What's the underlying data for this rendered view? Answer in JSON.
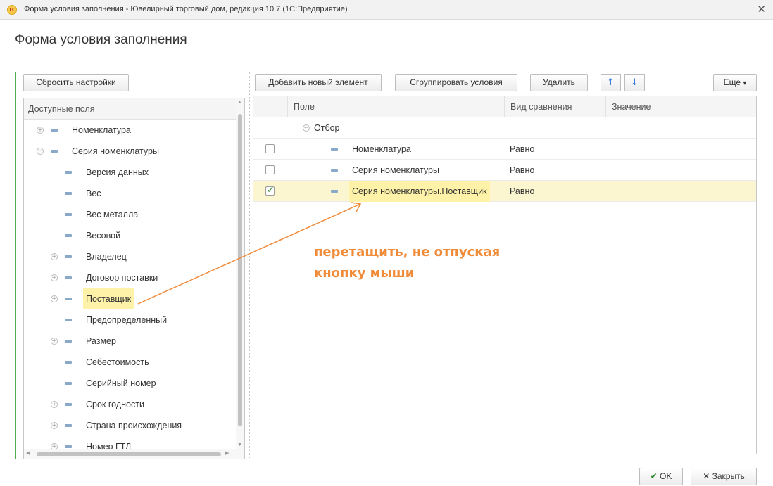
{
  "window": {
    "title": "Форма условия заполнения - Ювелирный торговый дом, редакция 10.7 (1С:Предприятие)",
    "logo_text": "1C"
  },
  "form": {
    "title": "Форма условия заполнения"
  },
  "left": {
    "reset_label": "Сбросить настройки",
    "header": "Доступные поля",
    "items": [
      {
        "label": "Номенклатура",
        "level": 0,
        "expander": "plus"
      },
      {
        "label": "Серия номенклатуры",
        "level": 0,
        "expander": "minus"
      },
      {
        "label": "Версия данных",
        "level": 1,
        "expander": "none"
      },
      {
        "label": "Вес",
        "level": 1,
        "expander": "none"
      },
      {
        "label": "Вес металла",
        "level": 1,
        "expander": "none"
      },
      {
        "label": "Весовой",
        "level": 1,
        "expander": "none"
      },
      {
        "label": "Владелец",
        "level": 1,
        "expander": "plus"
      },
      {
        "label": "Договор поставки",
        "level": 1,
        "expander": "plus"
      },
      {
        "label": "Поставщик",
        "level": 1,
        "expander": "plus",
        "highlighted": true
      },
      {
        "label": "Предопределенный",
        "level": 1,
        "expander": "none"
      },
      {
        "label": "Размер",
        "level": 1,
        "expander": "plus"
      },
      {
        "label": "Себестоимость",
        "level": 1,
        "expander": "none"
      },
      {
        "label": "Серийный номер",
        "level": 1,
        "expander": "none"
      },
      {
        "label": "Срок годности",
        "level": 1,
        "expander": "plus"
      },
      {
        "label": "Страна происхождения",
        "level": 1,
        "expander": "plus"
      },
      {
        "label": "Номер ГТД",
        "level": 1,
        "expander": "plus"
      }
    ]
  },
  "toolbar": {
    "add_label": "Добавить новый элемент",
    "group_label": "Сгруппировать условия",
    "delete_label": "Удалить",
    "up_icon": "↑",
    "down_icon": "↓",
    "more_label": "Еще",
    "more_arrow": "▾"
  },
  "grid": {
    "columns": {
      "field": "Поле",
      "comparison": "Вид сравнения",
      "value": "Значение"
    },
    "group": {
      "label": "Отбор",
      "expander": "minus"
    },
    "rows": [
      {
        "checked": false,
        "field": "Номенклатура",
        "comparison": "Равно",
        "value": ""
      },
      {
        "checked": false,
        "field": "Серия номенклатуры",
        "comparison": "Равно",
        "value": ""
      },
      {
        "checked": true,
        "field": "Серия номенклатуры.Поставщик",
        "comparison": "Равно",
        "value": "",
        "selected": true
      }
    ]
  },
  "annotation": {
    "line1": "перетащить, не отпуская",
    "line2": "кнопку мыши",
    "color": "#f08b3a"
  },
  "footer": {
    "ok_label": "OK",
    "close_label": "Закрыть"
  },
  "colors": {
    "accent": "#4caf50",
    "highlight": "#fdf2a8",
    "selected_row": "#fbf6d0"
  }
}
